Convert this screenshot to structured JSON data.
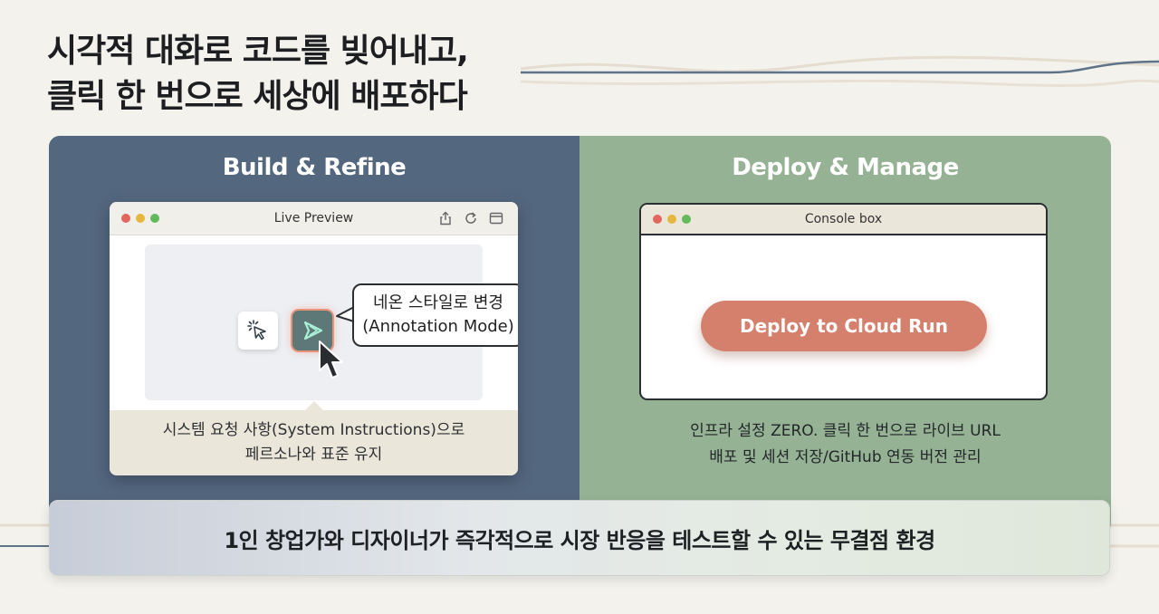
{
  "headline": {
    "line1": "시각적 대화로 코드를 빚어내고,",
    "line2": "클릭 한 번으로 세상에 배포하다"
  },
  "build_panel": {
    "title": "Build & Refine",
    "window": {
      "title": "Live Preview",
      "toolbar_icons": [
        "share-icon",
        "refresh-icon",
        "sidebar-icon"
      ]
    },
    "tools": [
      "sparkle-cursor-icon",
      "neon-send-icon"
    ],
    "bubble": {
      "line1": "네온 스타일로 변경",
      "line2": "(Annotation Mode)"
    },
    "caption": {
      "line1": "시스템 요청 사항(System Instructions)으로",
      "line2": "페르소나와 표준 유지"
    }
  },
  "deploy_panel": {
    "title": "Deploy & Manage",
    "window": {
      "title": "Console box"
    },
    "deploy_button_label": "Deploy to Cloud Run",
    "caption": {
      "line1": "인프라 설정 ZERO. 클릭 한 번으로 라이브 URL",
      "line2": "배포 및 세션 저장/GitHub 연동 버전 관리"
    }
  },
  "footer": {
    "text": "1인 창업가와 디자이너가 즉각적으로 시장 반응을 테스트할 수 있는 무결점 환경"
  },
  "colors": {
    "background": "#f4f2ed",
    "build_panel": "#53677f",
    "deploy_panel": "#95b294",
    "deploy_button": "#d5806c",
    "neon_accent": "#e57856"
  }
}
